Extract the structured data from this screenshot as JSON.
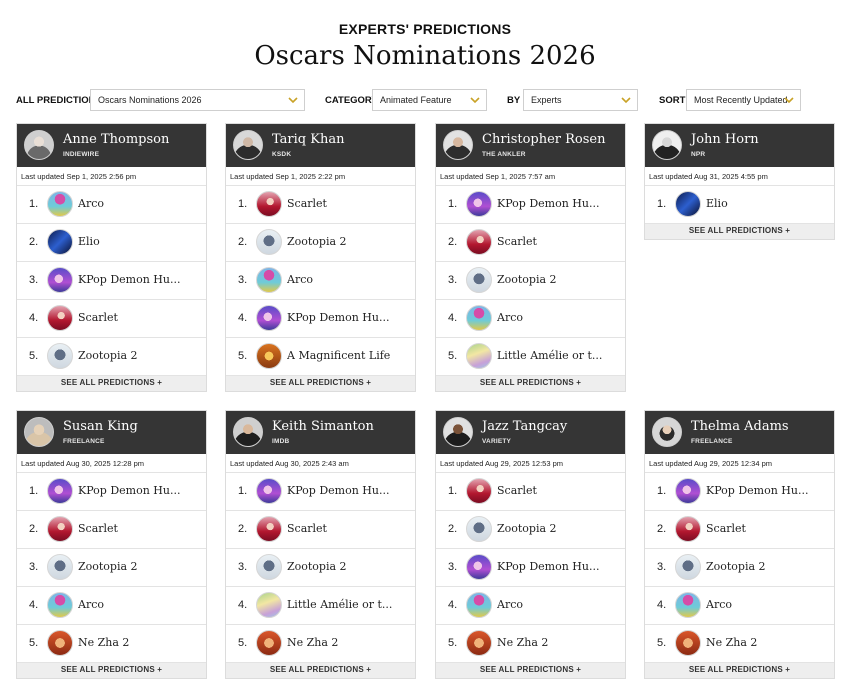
{
  "header": {
    "eyebrow": "EXPERTS' PREDICTIONS",
    "title": "Oscars Nominations 2026"
  },
  "filters": {
    "all_predictions_label": "ALL PREDICTIONS",
    "all_predictions_value": "Oscars Nominations 2026",
    "category_label": "CATEGORY",
    "category_value": "Animated Feature",
    "by_label": "BY",
    "by_value": "Experts",
    "sort_label": "SORT",
    "sort_value": "Most Recently Updated",
    "chevron_icon": "chevron-down-icon",
    "accent_color": "#c9a227"
  },
  "see_all_label": "SEE ALL PREDICTIONS +",
  "experts": [
    {
      "name": "Anne Thompson",
      "outlet": "INDIEWIRE",
      "updated": "Last updated Sep 1, 2025 2:56 pm",
      "picks": [
        {
          "rank": "1.",
          "title": "Arco",
          "thumb": "arco"
        },
        {
          "rank": "2.",
          "title": "Elio",
          "thumb": "elio"
        },
        {
          "rank": "3.",
          "title": "KPop Demon Hu...",
          "thumb": "kpop"
        },
        {
          "rank": "4.",
          "title": "Scarlet",
          "thumb": "scarlet"
        },
        {
          "rank": "5.",
          "title": "Zootopia 2",
          "thumb": "zootopia"
        }
      ]
    },
    {
      "name": "Tariq Khan",
      "outlet": "KSDK",
      "updated": "Last updated Sep 1, 2025 2:22 pm",
      "picks": [
        {
          "rank": "1.",
          "title": "Scarlet",
          "thumb": "scarlet"
        },
        {
          "rank": "2.",
          "title": "Zootopia 2",
          "thumb": "zootopia"
        },
        {
          "rank": "3.",
          "title": "Arco",
          "thumb": "arco"
        },
        {
          "rank": "4.",
          "title": "KPop Demon Hu...",
          "thumb": "kpop"
        },
        {
          "rank": "5.",
          "title": "A Magnificent Life",
          "thumb": "magnificent"
        }
      ]
    },
    {
      "name": "Christopher Rosen",
      "outlet": "THE ANKLER",
      "updated": "Last updated Sep 1, 2025 7:57 am",
      "picks": [
        {
          "rank": "1.",
          "title": "KPop Demon Hu...",
          "thumb": "kpop"
        },
        {
          "rank": "2.",
          "title": "Scarlet",
          "thumb": "scarlet"
        },
        {
          "rank": "3.",
          "title": "Zootopia 2",
          "thumb": "zootopia"
        },
        {
          "rank": "4.",
          "title": "Arco",
          "thumb": "arco"
        },
        {
          "rank": "5.",
          "title": "Little Amélie or t...",
          "thumb": "amelie"
        }
      ]
    },
    {
      "name": "John Horn",
      "outlet": "NPR",
      "updated": "Last updated Aug 31, 2025 4:55 pm",
      "picks": [
        {
          "rank": "1.",
          "title": "Elio",
          "thumb": "elio"
        }
      ]
    },
    {
      "name": "Susan King",
      "outlet": "FREELANCE",
      "updated": "Last updated Aug 30, 2025 12:28 pm",
      "picks": [
        {
          "rank": "1.",
          "title": "KPop Demon Hu...",
          "thumb": "kpop"
        },
        {
          "rank": "2.",
          "title": "Scarlet",
          "thumb": "scarlet"
        },
        {
          "rank": "3.",
          "title": "Zootopia 2",
          "thumb": "zootopia"
        },
        {
          "rank": "4.",
          "title": "Arco",
          "thumb": "arco"
        },
        {
          "rank": "5.",
          "title": "Ne Zha 2",
          "thumb": "nezha"
        }
      ]
    },
    {
      "name": "Keith Simanton",
      "outlet": "IMDB",
      "updated": "Last updated Aug 30, 2025 2:43 am",
      "picks": [
        {
          "rank": "1.",
          "title": "KPop Demon Hu...",
          "thumb": "kpop"
        },
        {
          "rank": "2.",
          "title": "Scarlet",
          "thumb": "scarlet"
        },
        {
          "rank": "3.",
          "title": "Zootopia 2",
          "thumb": "zootopia"
        },
        {
          "rank": "4.",
          "title": "Little Amélie or t...",
          "thumb": "amelie"
        },
        {
          "rank": "5.",
          "title": "Ne Zha 2",
          "thumb": "nezha"
        }
      ]
    },
    {
      "name": "Jazz Tangcay",
      "outlet": "VARIETY",
      "updated": "Last updated Aug 29, 2025 12:53 pm",
      "picks": [
        {
          "rank": "1.",
          "title": "Scarlet",
          "thumb": "scarlet"
        },
        {
          "rank": "2.",
          "title": "Zootopia 2",
          "thumb": "zootopia"
        },
        {
          "rank": "3.",
          "title": "KPop Demon Hu...",
          "thumb": "kpop"
        },
        {
          "rank": "4.",
          "title": "Arco",
          "thumb": "arco"
        },
        {
          "rank": "5.",
          "title": "Ne Zha 2",
          "thumb": "nezha"
        }
      ]
    },
    {
      "name": "Thelma Adams",
      "outlet": "FREELANCE",
      "updated": "Last updated Aug 29, 2025 12:34 pm",
      "picks": [
        {
          "rank": "1.",
          "title": "KPop Demon Hu...",
          "thumb": "kpop"
        },
        {
          "rank": "2.",
          "title": "Scarlet",
          "thumb": "scarlet"
        },
        {
          "rank": "3.",
          "title": "Zootopia 2",
          "thumb": "zootopia"
        },
        {
          "rank": "4.",
          "title": "Arco",
          "thumb": "arco"
        },
        {
          "rank": "5.",
          "title": "Ne Zha 2",
          "thumb": "nezha"
        }
      ]
    }
  ]
}
